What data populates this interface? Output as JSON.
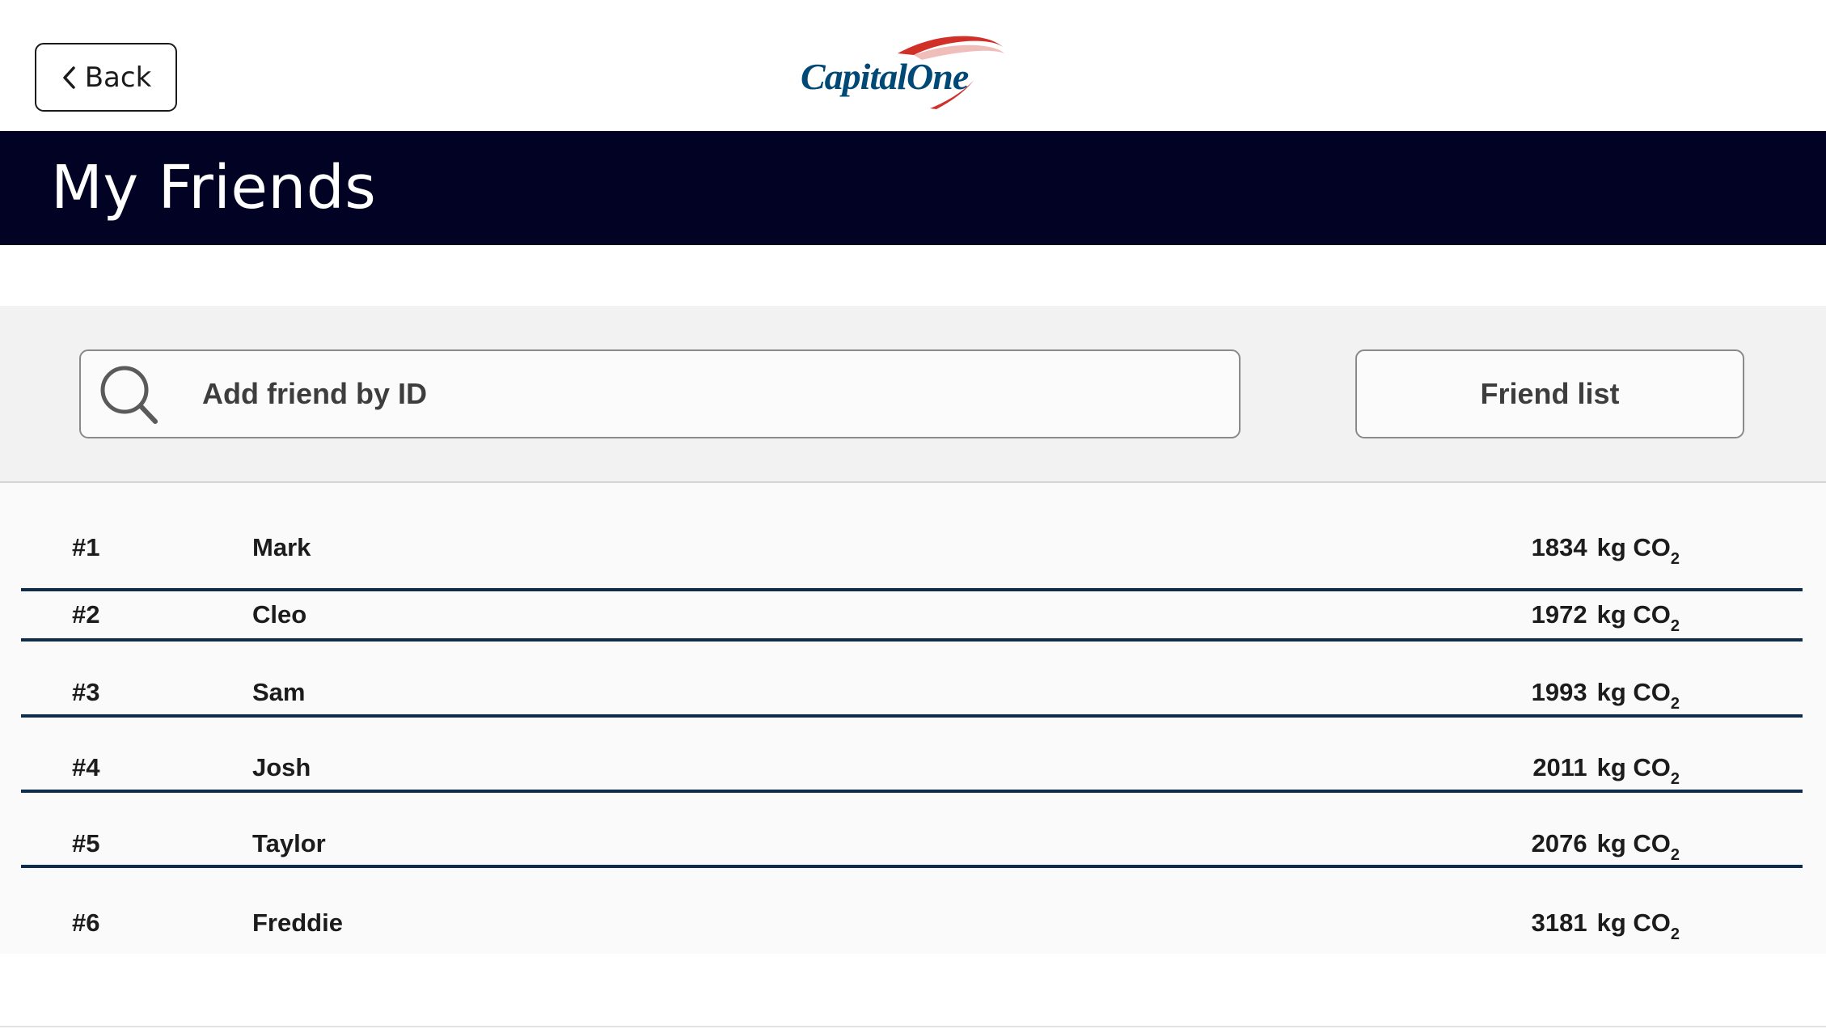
{
  "header": {
    "back_label": "Back",
    "logo_text": "CapitalOne",
    "brand_colors": {
      "navy": "#004977",
      "red": "#D03027"
    }
  },
  "banner": {
    "title": "My Friends",
    "background": "#020324"
  },
  "search": {
    "placeholder": "Add friend by ID",
    "value": "",
    "icon": "search-icon"
  },
  "friend_list_button": {
    "label": "Friend list"
  },
  "friends": {
    "unit_prefix": "kg CO",
    "unit_subscript": "2",
    "divider_color": "#0E2D4E",
    "rows": [
      {
        "rank": "#1",
        "name": "Mark",
        "value": "1834"
      },
      {
        "rank": "#2",
        "name": "Cleo",
        "value": "1972"
      },
      {
        "rank": "#3",
        "name": "Sam",
        "value": "1993"
      },
      {
        "rank": "#4",
        "name": "Josh",
        "value": "2011"
      },
      {
        "rank": "#5",
        "name": "Taylor",
        "value": "2076"
      },
      {
        "rank": "#6",
        "name": "Freddie",
        "value": "3181"
      }
    ]
  }
}
